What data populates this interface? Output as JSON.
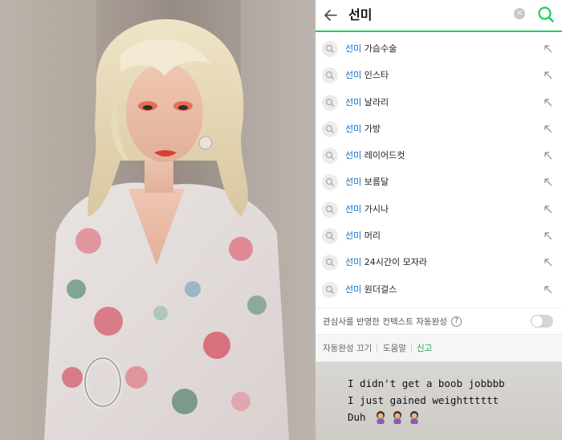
{
  "photo": {
    "description_icon": "portrait-photo"
  },
  "search": {
    "query": "선미",
    "back_icon": "arrow-left-icon",
    "clear_icon": "clear-icon",
    "search_icon": "search-icon",
    "accent_color": "#19ce60"
  },
  "suggestions": [
    {
      "highlight": "선미",
      "rest": " 가슴수술"
    },
    {
      "highlight": "선미",
      "rest": " 인스타"
    },
    {
      "highlight": "선미",
      "rest": " 날라리"
    },
    {
      "highlight": "선미",
      "rest": " 가방"
    },
    {
      "highlight": "선미",
      "rest": " 레이어드컷"
    },
    {
      "highlight": "선미",
      "rest": " 보름달"
    },
    {
      "highlight": "선미",
      "rest": " 가시나"
    },
    {
      "highlight": "선미",
      "rest": " 머리"
    },
    {
      "highlight": "선미",
      "rest": " 24시간이 모자라"
    },
    {
      "highlight": "선미",
      "rest": " 원더걸스"
    }
  ],
  "context": {
    "label": "관심사를 반영한 컨텍스트 자동완성",
    "help": "?",
    "toggle_on": false
  },
  "footer": {
    "autocomplete_off": "자동완성 끄기",
    "help": "도움말",
    "report": "신고",
    "report_color": "#19a34a"
  },
  "caption": {
    "line1": "I didn't get a boob jobbbb",
    "line2": "I just gained weightttttt",
    "line3": "Duh"
  }
}
